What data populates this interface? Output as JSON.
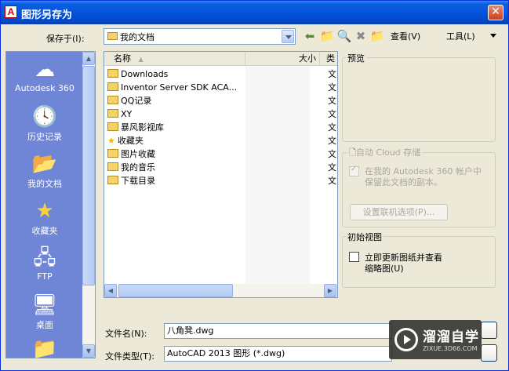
{
  "window": {
    "title": "图形另存为",
    "app_icon_letter": "A"
  },
  "save_in": {
    "label": "保存于(I):",
    "value": "我的文档"
  },
  "toolbar": {
    "view_label": "查看(V)",
    "tools_label": "工具(L)"
  },
  "places": [
    {
      "label": "Autodesk 360",
      "icon": "cloud-icon"
    },
    {
      "label": "历史记录",
      "icon": "history-icon"
    },
    {
      "label": "我的文档",
      "icon": "documents-folder-icon"
    },
    {
      "label": "收藏夹",
      "icon": "favorites-star-icon"
    },
    {
      "label": "FTP",
      "icon": "ftp-icon"
    },
    {
      "label": "桌面",
      "icon": "desktop-icon"
    }
  ],
  "file_list": {
    "columns": {
      "name": "名称",
      "size": "大小",
      "type": "类"
    },
    "rows": [
      {
        "name": "Downloads",
        "type": "文"
      },
      {
        "name": "Inventor Server SDK ACA...",
        "type": "文"
      },
      {
        "name": "QQ记录",
        "type": "文"
      },
      {
        "name": "XY",
        "type": "文"
      },
      {
        "name": "暴风影视库",
        "type": "文"
      },
      {
        "name": "收藏夹",
        "type": "文"
      },
      {
        "name": "图片收藏",
        "type": "文"
      },
      {
        "name": "我的音乐",
        "type": "文"
      },
      {
        "name": "下载目录",
        "type": "文"
      }
    ]
  },
  "preview": {
    "title": "预览"
  },
  "cloud": {
    "title": "自动 Cloud 存储",
    "checkbox_label_1": "在我的 Autodesk 360 帐户中",
    "checkbox_label_2": "保留此文档的副本。",
    "options_button": "设置联机选项(P)..."
  },
  "initial_view": {
    "title": "初始视图",
    "checkbox_label_1": "立即更新图纸并查看",
    "checkbox_label_2": "缩略图(U)"
  },
  "filename": {
    "label": "文件名(N):",
    "value": "八角凳.dwg"
  },
  "filetype": {
    "label": "文件类型(T):",
    "value": "AutoCAD 2013 图形 (*.dwg)"
  },
  "watermark": {
    "title": "溜溜自学",
    "subtitle": "ZIXUE.3D66.COM"
  }
}
